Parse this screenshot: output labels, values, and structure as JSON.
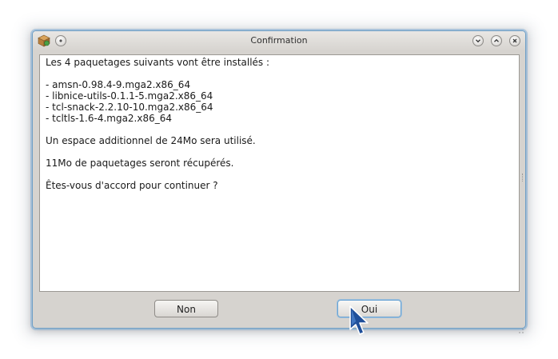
{
  "window": {
    "title": "Confirmation"
  },
  "dialog": {
    "lines": [
      "Les 4 paquetages suivants vont être installés :",
      "",
      "- amsn-0.98.4-9.mga2.x86_64",
      "- libnice-utils-0.1.1-5.mga2.x86_64",
      "- tcl-snack-2.2.10-10.mga2.x86_64",
      "- tcltls-1.6-4.mga2.x86_64",
      "",
      "Un espace additionnel de 24Mo sera utilisé.",
      "",
      "11Mo de paquetages seront récupérés.",
      "",
      "Êtes-vous d'accord pour continuer ?"
    ]
  },
  "buttons": {
    "no_label": "Non",
    "yes_label": "Oui"
  },
  "colors": {
    "window_border": "#6f9fc6",
    "focus_accent": "#6aa4d4",
    "cursor_fill": "#1f4f9a"
  }
}
